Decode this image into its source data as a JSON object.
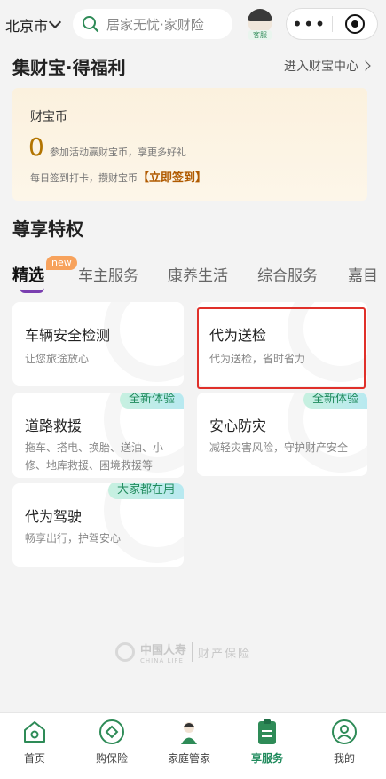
{
  "header": {
    "city": "北京市",
    "search_placeholder": "居家无忧·家财险",
    "service_tag": "客服"
  },
  "treasure": {
    "title": "集财宝·得福利",
    "link": "进入财宝中心",
    "coin_label": "财宝币",
    "coin_value": "0",
    "coin_desc": "参加活动赢财宝币，享更多好礼",
    "sign_text": "每日签到打卡，攒财宝币",
    "sign_button": "【立即签到】"
  },
  "privilege": {
    "title": "尊享特权",
    "tabs": [
      {
        "label": "精选",
        "badge": "new"
      },
      {
        "label": "车主服务"
      },
      {
        "label": "康养生活"
      },
      {
        "label": "综合服务"
      },
      {
        "label": "嘉目"
      }
    ],
    "cards": [
      {
        "title": "车辆安全检测",
        "desc": "让您旅途放心",
        "ribbon": ""
      },
      {
        "title": "代为送检",
        "desc": "代为送检，省时省力",
        "ribbon": ""
      },
      {
        "title": "道路救援",
        "desc": "拖车、搭电、换胎、送油、小修、地库救援、困境救援等",
        "ribbon": "全新体验"
      },
      {
        "title": "安心防灾",
        "desc": "减轻灾害风险，守护财产安全",
        "ribbon": "全新体验"
      },
      {
        "title": "代为驾驶",
        "desc": "畅享出行，护驾安心",
        "ribbon": "大家都在用"
      }
    ]
  },
  "footer_logo": {
    "cn": "中国人寿",
    "en": "CHINA LIFE",
    "sub": "财产保险"
  },
  "bottom_nav": [
    {
      "label": "首页",
      "icon": "home-icon"
    },
    {
      "label": "购保险",
      "icon": "diamond-icon"
    },
    {
      "label": "家庭管家",
      "icon": "assistant-avatar-icon"
    },
    {
      "label": "享服务",
      "icon": "clipboard-icon",
      "active": true
    },
    {
      "label": "我的",
      "icon": "user-icon"
    }
  ],
  "colors": {
    "accent": "#1f8a5c",
    "highlight_box": "#e0302a",
    "coin": "#b27400"
  }
}
